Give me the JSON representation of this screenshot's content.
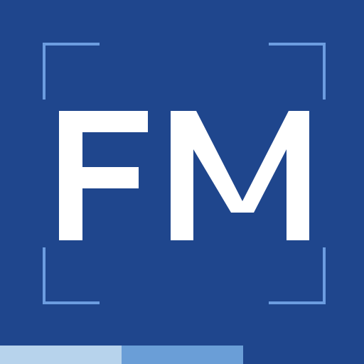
{
  "logo": {
    "text": "FM"
  },
  "colors": {
    "background": "#1f468d",
    "corner": "#6c9de0",
    "monogram": "#ffffff",
    "stripe_light": "#b7d3ec",
    "stripe_mid": "#6a9ed7",
    "stripe_dark": "#1f468d"
  }
}
